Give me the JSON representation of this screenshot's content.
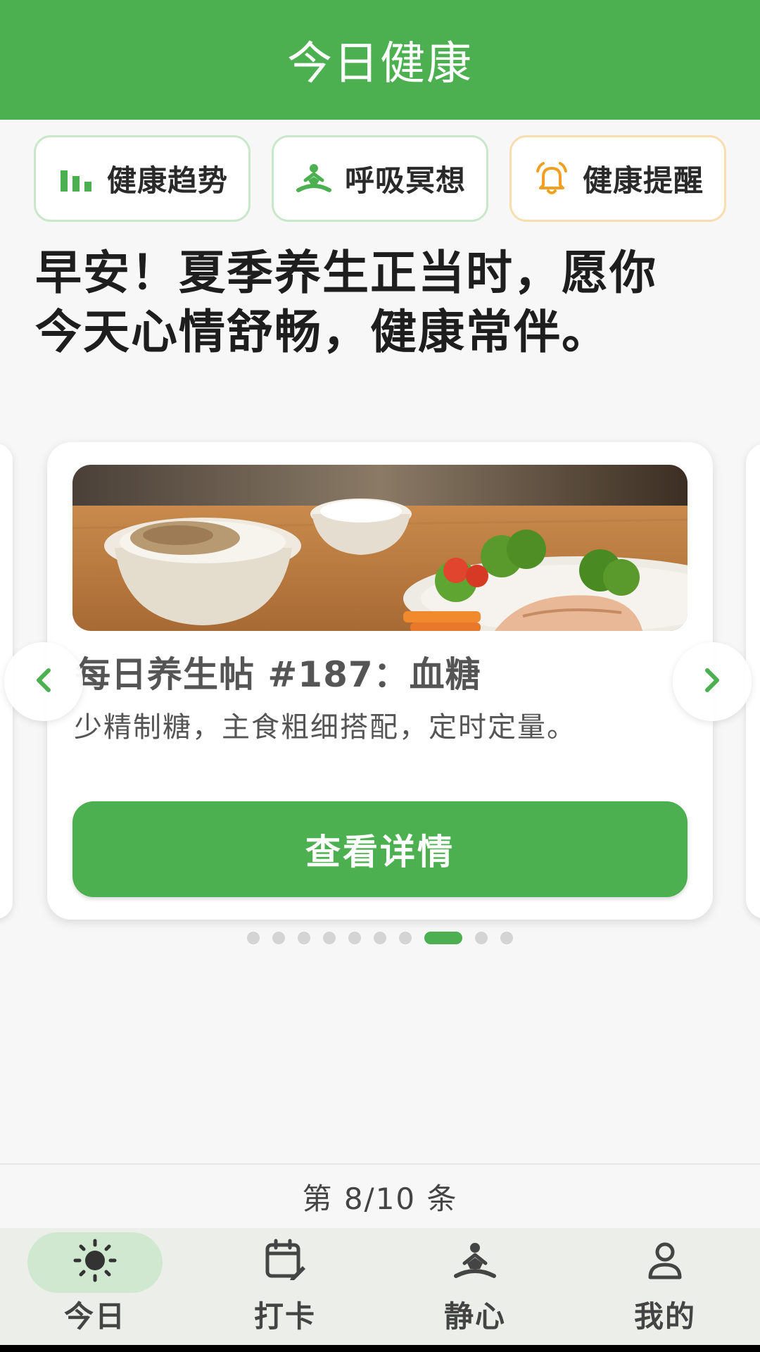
{
  "header": {
    "title": "今日健康"
  },
  "quick_actions": [
    {
      "label": "健康趋势",
      "icon": "bar-chart-icon",
      "color": "#4caf50"
    },
    {
      "label": "呼吸冥想",
      "icon": "meditation-icon",
      "color": "#4caf50"
    },
    {
      "label": "健康提醒",
      "icon": "bell-icon",
      "color": "#f0a020"
    }
  ],
  "greeting": "早安！夏季养生正当时，愿你今天心情舒畅，健康常伴。",
  "card": {
    "image": "healthy-meal-image",
    "title": "每日养生帖 #187：血糖",
    "description": "少精制糖，主食粗细搭配，定时定量。",
    "button_label": "查看详情"
  },
  "pagination": {
    "total": 10,
    "current": 8
  },
  "counter": "第 8/10 条",
  "bottom_nav": [
    {
      "label": "今日",
      "icon": "sun-icon",
      "active": true
    },
    {
      "label": "打卡",
      "icon": "calendar-check-icon",
      "active": false
    },
    {
      "label": "静心",
      "icon": "meditation-icon",
      "active": false
    },
    {
      "label": "我的",
      "icon": "user-icon",
      "active": false
    }
  ],
  "colors": {
    "primary": "#4caf50",
    "warning": "#f0a020",
    "background": "#f7f7f7"
  }
}
